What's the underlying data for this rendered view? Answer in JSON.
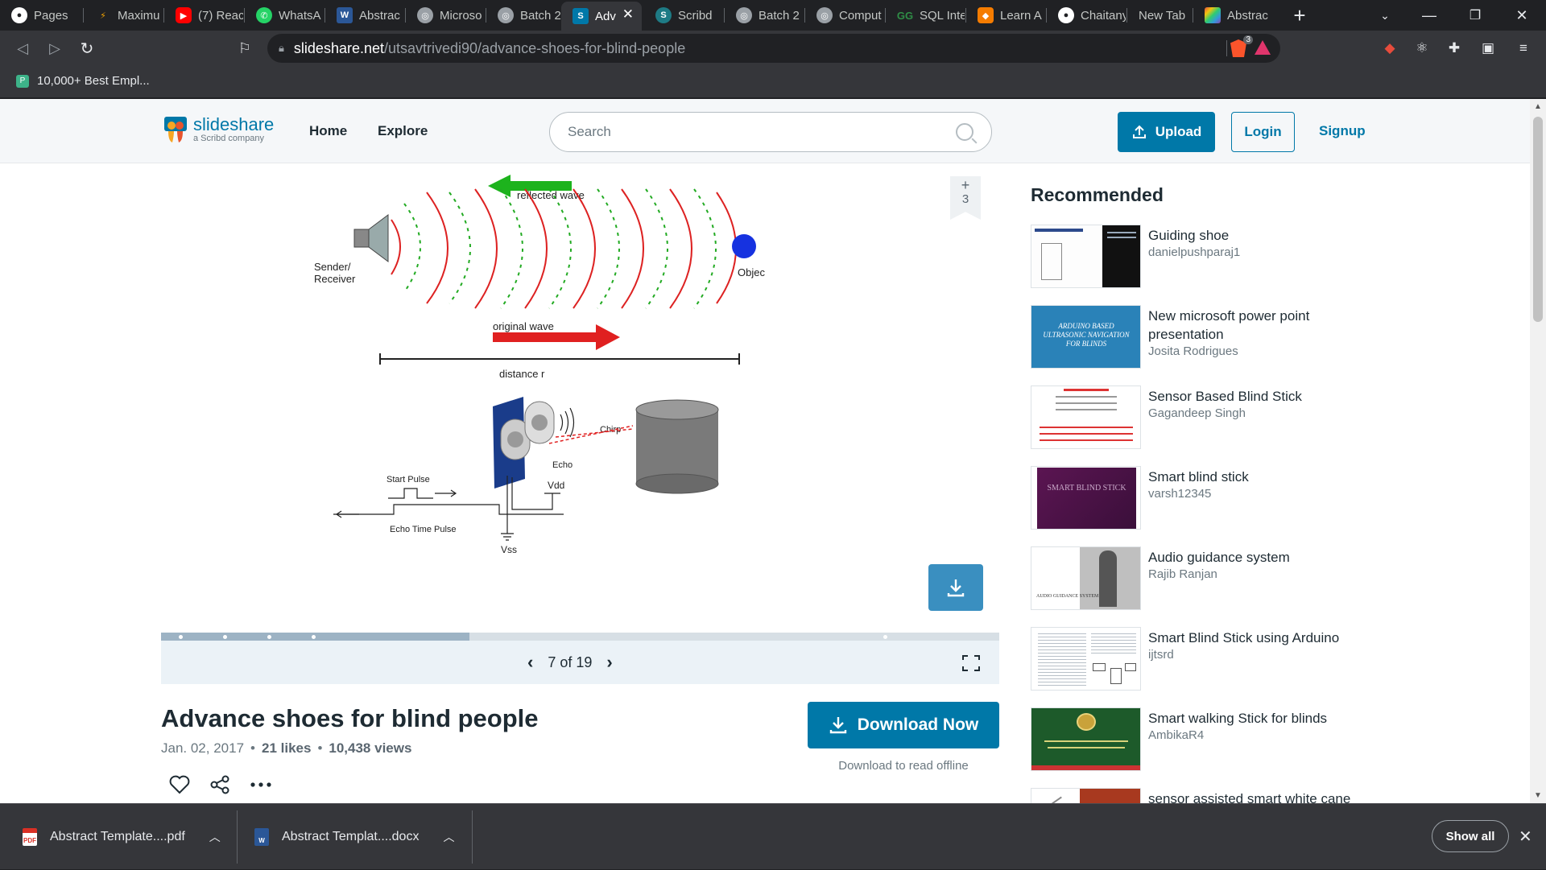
{
  "browser": {
    "tabs": [
      {
        "label": "Pages",
        "icon": "github-icon",
        "color": "#ffffff"
      },
      {
        "label": "Maximu",
        "icon": "maximum-icon",
        "color": "#f4a300"
      },
      {
        "label": "(7) Reac",
        "icon": "youtube-icon",
        "color": "#ff0000"
      },
      {
        "label": "WhatsA",
        "icon": "whatsapp-icon",
        "color": "#25d366"
      },
      {
        "label": "Abstrac",
        "icon": "word-icon",
        "color": "#2b5797"
      },
      {
        "label": "Microso",
        "icon": "globe-icon",
        "color": "#9aa0a6"
      },
      {
        "label": "Batch 2",
        "icon": "globe-icon",
        "color": "#9aa0a6"
      },
      {
        "label": "Adv",
        "icon": "slideshare-icon",
        "color": "#0078a8",
        "active": true
      },
      {
        "label": "Scribd",
        "icon": "scribd-icon",
        "color": "#1e7b85"
      },
      {
        "label": "Batch 2",
        "icon": "globe-icon",
        "color": "#9aa0a6"
      },
      {
        "label": "Comput",
        "icon": "globe-icon",
        "color": "#9aa0a6"
      },
      {
        "label": "SQL Inte",
        "icon": "gfg-icon",
        "color": "#2f8d46"
      },
      {
        "label": "Learn A",
        "icon": "learn-icon",
        "color": "#f57c00"
      },
      {
        "label": "Chaitany",
        "icon": "github-icon",
        "color": "#ffffff"
      },
      {
        "label": "New Tab",
        "icon": "",
        "color": ""
      },
      {
        "label": "Abstrac",
        "icon": "canva-icon",
        "color": "#8e44ad"
      }
    ],
    "url_host": "slideshare.net",
    "url_path": "/utsavtrivedi90/advance-shoes-for-blind-people",
    "bookmark": "10,000+ Best Empl...",
    "brave_badge": "3"
  },
  "site": {
    "logo_main": "slideshare",
    "logo_sub": "a Scribd company",
    "nav": [
      "Home",
      "Explore"
    ],
    "search_placeholder": "Search",
    "upload": "Upload",
    "login": "Login",
    "signup": "Signup"
  },
  "slide": {
    "labels": {
      "reflected": "reflected wave",
      "sender": "Sender/",
      "receiver": "Receiver",
      "object": "Object",
      "original": "original wave",
      "distance": "distance r",
      "chirp": "Chirp",
      "echo": "Echo",
      "start_pulse": "Start Pulse",
      "vdd": "Vdd",
      "echo_time": "Echo Time Pulse",
      "vss": "Vss"
    },
    "bookmark_count": "3",
    "page_label": "7 of 19",
    "progress_fraction": 0.368
  },
  "document": {
    "title": "Advance shoes for blind people",
    "date": "Jan. 02, 2017",
    "likes": "21 likes",
    "views": "10,438 views",
    "download_now": "Download Now",
    "download_offline": "Download to read offline"
  },
  "recommended": {
    "heading": "Recommended",
    "items": [
      {
        "title": "Guiding shoe",
        "author": "danielpushparaj1"
      },
      {
        "title": "New microsoft power point presentation",
        "author": "Josita Rodrigues"
      },
      {
        "title": "Sensor Based Blind Stick",
        "author": "Gagandeep Singh"
      },
      {
        "title": "Smart blind stick",
        "author": "varsh12345"
      },
      {
        "title": "Audio guidance system",
        "author": "Rajib Ranjan"
      },
      {
        "title": "Smart Blind Stick using Arduino",
        "author": "ijtsrd"
      },
      {
        "title": "Smart walking Stick for blinds",
        "author": "AmbikaR4"
      },
      {
        "title": "sensor assisted smart white cane",
        "author": ""
      }
    ],
    "thumb_texts": {
      "t2": "ARDUINO BASED ULTRASONIC NAVIGATION FOR BLINDS",
      "t4": "SMART BLIND STICK",
      "t5": "AUDIO GUIDANCE SYSTEM"
    }
  },
  "downloads": {
    "items": [
      {
        "name": "Abstract Template....pdf",
        "type": "pdf"
      },
      {
        "name": "Abstract Templat....docx",
        "type": "docx"
      }
    ],
    "show_all": "Show all"
  }
}
